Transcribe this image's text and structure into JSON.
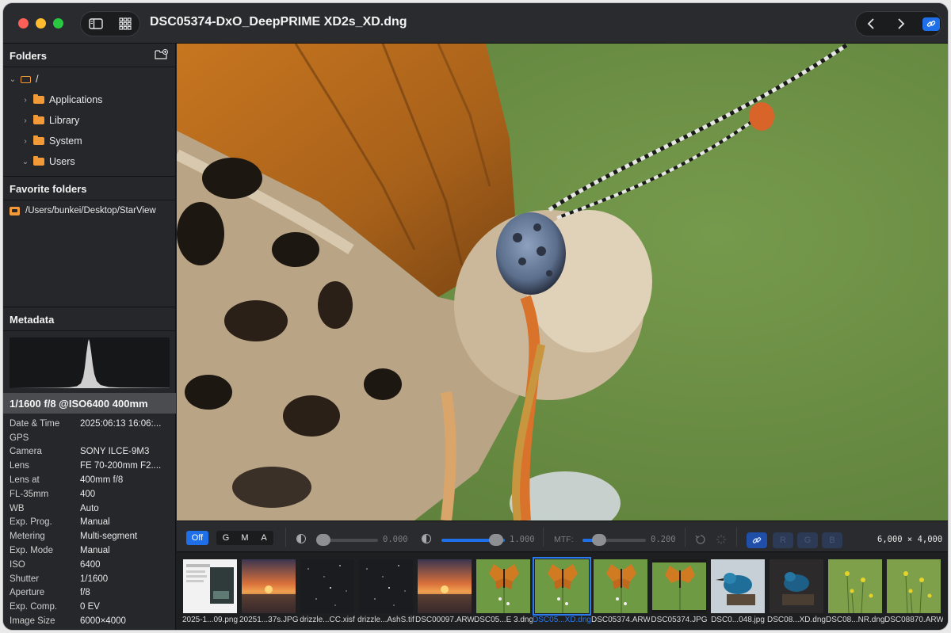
{
  "window": {
    "title": "DSC05374-DxO_DeepPRIME XD2s_XD.dng"
  },
  "icons": {
    "sidebar_toggle": "sidebar-toggle-icon",
    "grid_view": "grid-icon",
    "back": "chevron-left-icon",
    "forward": "chevron-right-icon",
    "link": "link-icon",
    "new_folder": "new-folder-icon"
  },
  "folders": {
    "header": "Folders",
    "root": "/",
    "items": [
      "Applications",
      "Library",
      "System",
      "Users"
    ]
  },
  "favorites": {
    "header": "Favorite folders",
    "items": [
      "/Users/bunkei/Desktop/StarView"
    ]
  },
  "metadata": {
    "header": "Metadata",
    "summary": "1/1600 f/8 @ISO6400 400mm",
    "rows": [
      {
        "key": "Date & Time",
        "value": "2025:06:13 16:06:..."
      },
      {
        "key": "GPS",
        "value": ""
      },
      {
        "key": "Camera",
        "value": "SONY ILCE-9M3"
      },
      {
        "key": "Lens",
        "value": "FE 70-200mm F2...."
      },
      {
        "key": "Lens at",
        "value": "400mm f/8"
      },
      {
        "key": "FL-35mm",
        "value": "400"
      },
      {
        "key": "WB",
        "value": "Auto"
      },
      {
        "key": "Exp. Prog.",
        "value": "Manual"
      },
      {
        "key": "Metering",
        "value": "Multi-segment"
      },
      {
        "key": "Exp. Mode",
        "value": "Manual"
      },
      {
        "key": "ISO",
        "value": "6400"
      },
      {
        "key": "Shutter",
        "value": "1/1600"
      },
      {
        "key": "Aperture",
        "value": "f/8"
      },
      {
        "key": "Exp. Comp.",
        "value": "0 EV"
      },
      {
        "key": "Image Size",
        "value": "6000×4000"
      }
    ]
  },
  "toolbar": {
    "off_label": "Off",
    "channels": [
      "G",
      "M",
      "A"
    ],
    "black_point_value": "0.000",
    "white_point_value": "1.000",
    "mtf_label": "MTF:",
    "mtf_value": "0.200",
    "rgb": [
      "R",
      "G",
      "B"
    ],
    "resolution": "6,000 × 4,000",
    "black_level": 0.0,
    "white_level": 1.0,
    "mtf_level": 0.2
  },
  "filmstrip": {
    "selected_index": 6,
    "items": [
      {
        "name": "2025-1...09.png",
        "kind": "screenshot"
      },
      {
        "name": "20251...37s.JPG",
        "kind": "sunset"
      },
      {
        "name": "drizzle...CC.xisf",
        "kind": "stars"
      },
      {
        "name": "drizzle...AshS.tif",
        "kind": "stars"
      },
      {
        "name": "DSC00097.ARW",
        "kind": "sunset"
      },
      {
        "name": "DSC05...E 3.dng",
        "kind": "butterfly"
      },
      {
        "name": "DSC05...XD.dng",
        "kind": "butterfly"
      },
      {
        "name": "DSC05374.ARW",
        "kind": "butterfly"
      },
      {
        "name": "DSC05374.JPG",
        "kind": "butterfly-dark"
      },
      {
        "name": "DSC0...048.jpg",
        "kind": "bird"
      },
      {
        "name": "DSC08...XD.dng",
        "kind": "bird-dark"
      },
      {
        "name": "DSC08...NR.dng",
        "kind": "flowers"
      },
      {
        "name": "DSC08870.ARW",
        "kind": "flowers"
      }
    ]
  },
  "colors": {
    "accent": "#1f6fe8",
    "folder": "#f29a38",
    "selected_label": "#2a7bf0"
  }
}
